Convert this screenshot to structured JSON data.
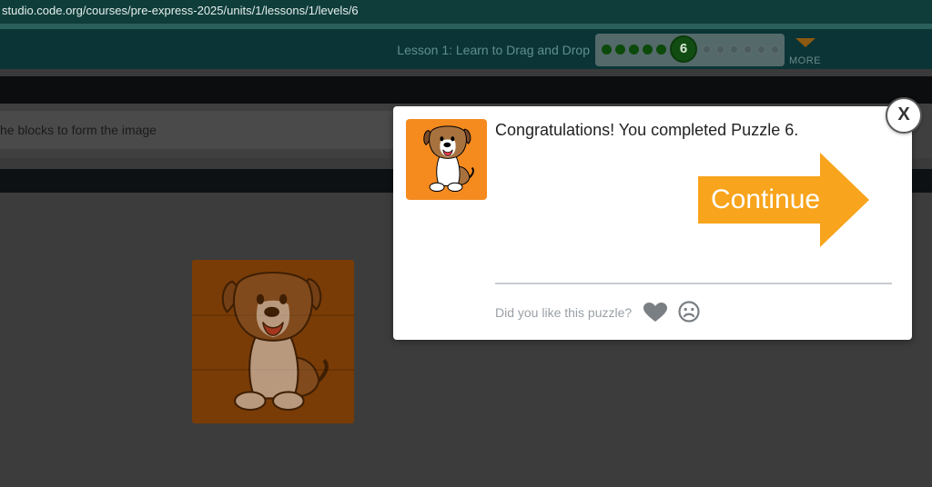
{
  "browser": {
    "url": "studio.code.org/courses/pre-express-2025/units/1/lessons/1/levels/6"
  },
  "header": {
    "lesson_title": "Lesson 1: Learn to Drag and Drop",
    "progress": {
      "completed_levels": 5,
      "current_level": "6",
      "remaining_levels": 7
    },
    "more_label": "MORE"
  },
  "instruction": {
    "text": "he blocks to form the image"
  },
  "dialog": {
    "message": "Congratulations! You completed Puzzle 6.",
    "continue_label": "Continue",
    "feedback_question": "Did you like this puzzle?",
    "close_label": "X"
  },
  "icons": {
    "heart": "heart-icon",
    "sad": "sad-face-icon",
    "more_caret": "caret-down-icon",
    "puppy": "puppy-image"
  },
  "colors": {
    "accent_orange": "#f8a41c",
    "image_bg": "#f58a1f",
    "header_bg": "#0b3436",
    "progress_done": "#0b4a0a"
  }
}
